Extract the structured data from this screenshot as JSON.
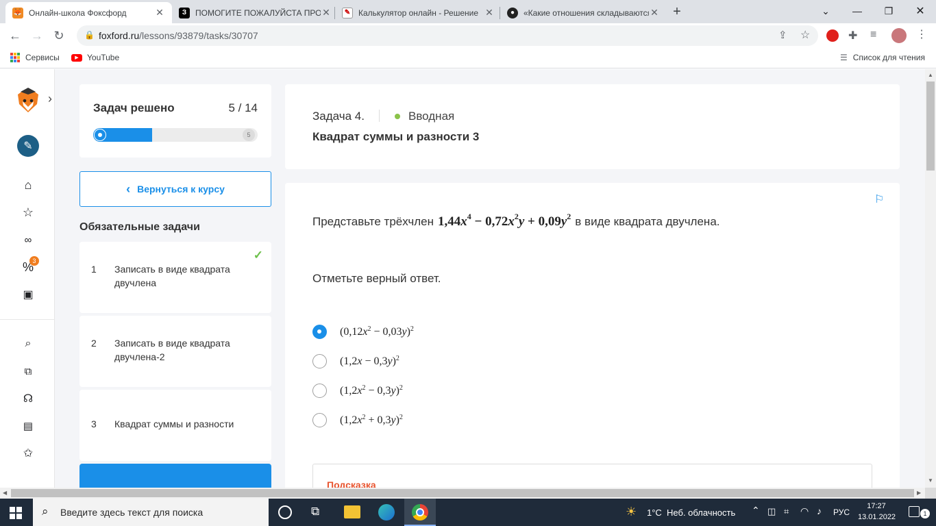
{
  "browser": {
    "tabs": [
      {
        "title": "Онлайн-школа Фоксфорд",
        "active": true
      },
      {
        "title": "ПОМОГИТЕ ПОЖАЛУЙСТА ПРОШУ",
        "active": false
      },
      {
        "title": "Калькулятор онлайн - Решение",
        "active": false
      },
      {
        "title": "«Какие отношения складываются",
        "active": false
      }
    ],
    "new_tab_symbol": "+",
    "url_host": "foxford.ru",
    "url_path": "/lessons/93879/tasks/30707",
    "bookmarks": [
      {
        "label": "Сервисы"
      },
      {
        "label": "YouTube"
      }
    ],
    "reading_list": "Список для чтения"
  },
  "sidebar": {
    "notification_badge": "3"
  },
  "progress": {
    "label": "Задач решено",
    "count": "5 / 14",
    "solved": 5,
    "total": 14,
    "end_marker": "5"
  },
  "back_button": "Вернуться к курсу",
  "section_title": "Обязательные задачи",
  "tasks": [
    {
      "num": "1",
      "label": "Записать в виде квадрата двучлена",
      "done": true
    },
    {
      "num": "2",
      "label": "Записать в виде квадрата двучлена-2",
      "done": false
    },
    {
      "num": "3",
      "label": "Квадрат суммы и разности",
      "done": false
    }
  ],
  "header": {
    "task_no": "Задача 4.",
    "level": "Вводная",
    "level_color": "#8bc34a",
    "title": "Квадрат суммы и разности 3"
  },
  "problem": {
    "text_before": "Представьте трёхчлен",
    "text_after": "в виде квадрата двучлена.",
    "instruction": "Отметьте верный ответ.",
    "hint_label": "Подсказка"
  },
  "options": [
    {
      "selected": true
    },
    {
      "selected": false
    },
    {
      "selected": false
    },
    {
      "selected": false
    }
  ],
  "taskbar": {
    "search_placeholder": "Введите здесь текст для поиска",
    "weather": "1°C  Неб. облачность",
    "lang": "РУС",
    "time": "17:27",
    "date": "13.01.2022",
    "notif_count": "1"
  },
  "colors": {
    "accent": "#1a8fe8",
    "done_check": "#6cc04a",
    "hint": "#e8542f"
  }
}
